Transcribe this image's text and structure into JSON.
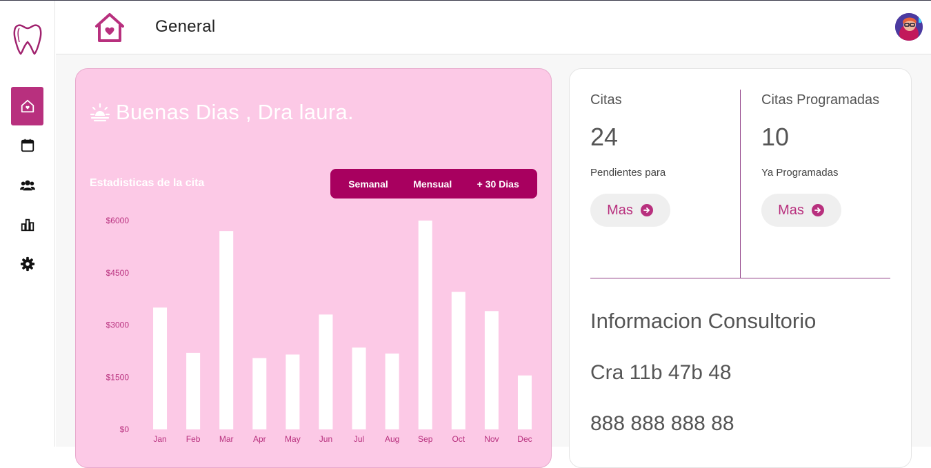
{
  "header": {
    "title": "General"
  },
  "sidebar": {
    "items": [
      {
        "name": "home",
        "icon": "home-icon",
        "active": true
      },
      {
        "name": "calendar",
        "icon": "calendar-icon",
        "active": false
      },
      {
        "name": "patients",
        "icon": "users-icon",
        "active": false
      },
      {
        "name": "reports",
        "icon": "chart-icon",
        "active": false
      },
      {
        "name": "settings",
        "icon": "gear-icon",
        "active": false
      }
    ]
  },
  "greeting": {
    "text": "Buenas Dias , Dra laura."
  },
  "stats": {
    "label": "Estadisticas de la cita",
    "ranges": [
      "Semanal",
      "Mensual",
      "+ 30 Dias"
    ]
  },
  "chart_data": {
    "type": "bar",
    "categories": [
      "Jan",
      "Feb",
      "Mar",
      "Apr",
      "May",
      "Jun",
      "Jul",
      "Aug",
      "Sep",
      "Oct",
      "Nov",
      "Dec"
    ],
    "values": [
      3500,
      2200,
      5700,
      2050,
      2150,
      3300,
      2350,
      2180,
      6000,
      3950,
      3400,
      1550
    ],
    "ylim": [
      0,
      6000
    ],
    "yticks": [
      0,
      1500,
      3000,
      4500,
      6000
    ],
    "ytick_labels": [
      "$0",
      "$1500",
      "$3000",
      "$4500",
      "$6000"
    ],
    "grid": false
  },
  "citas": {
    "title": "Citas",
    "count": "24",
    "subtitle": "Pendientes para",
    "button": "Mas"
  },
  "programadas": {
    "title": "Citas Programadas",
    "count": "10",
    "subtitle": "Ya Programadas",
    "button": "Mas"
  },
  "consultorio": {
    "title": "Informacion Consultorio",
    "address": "Cra 11b 47b 48",
    "phone": "888 888 888 88"
  },
  "colors": {
    "accent": "#b8307e",
    "card_pink": "#fcc9e6",
    "range_bg": "#a8005f",
    "bar": "#ffffff",
    "axis_text": "#b8307e"
  }
}
